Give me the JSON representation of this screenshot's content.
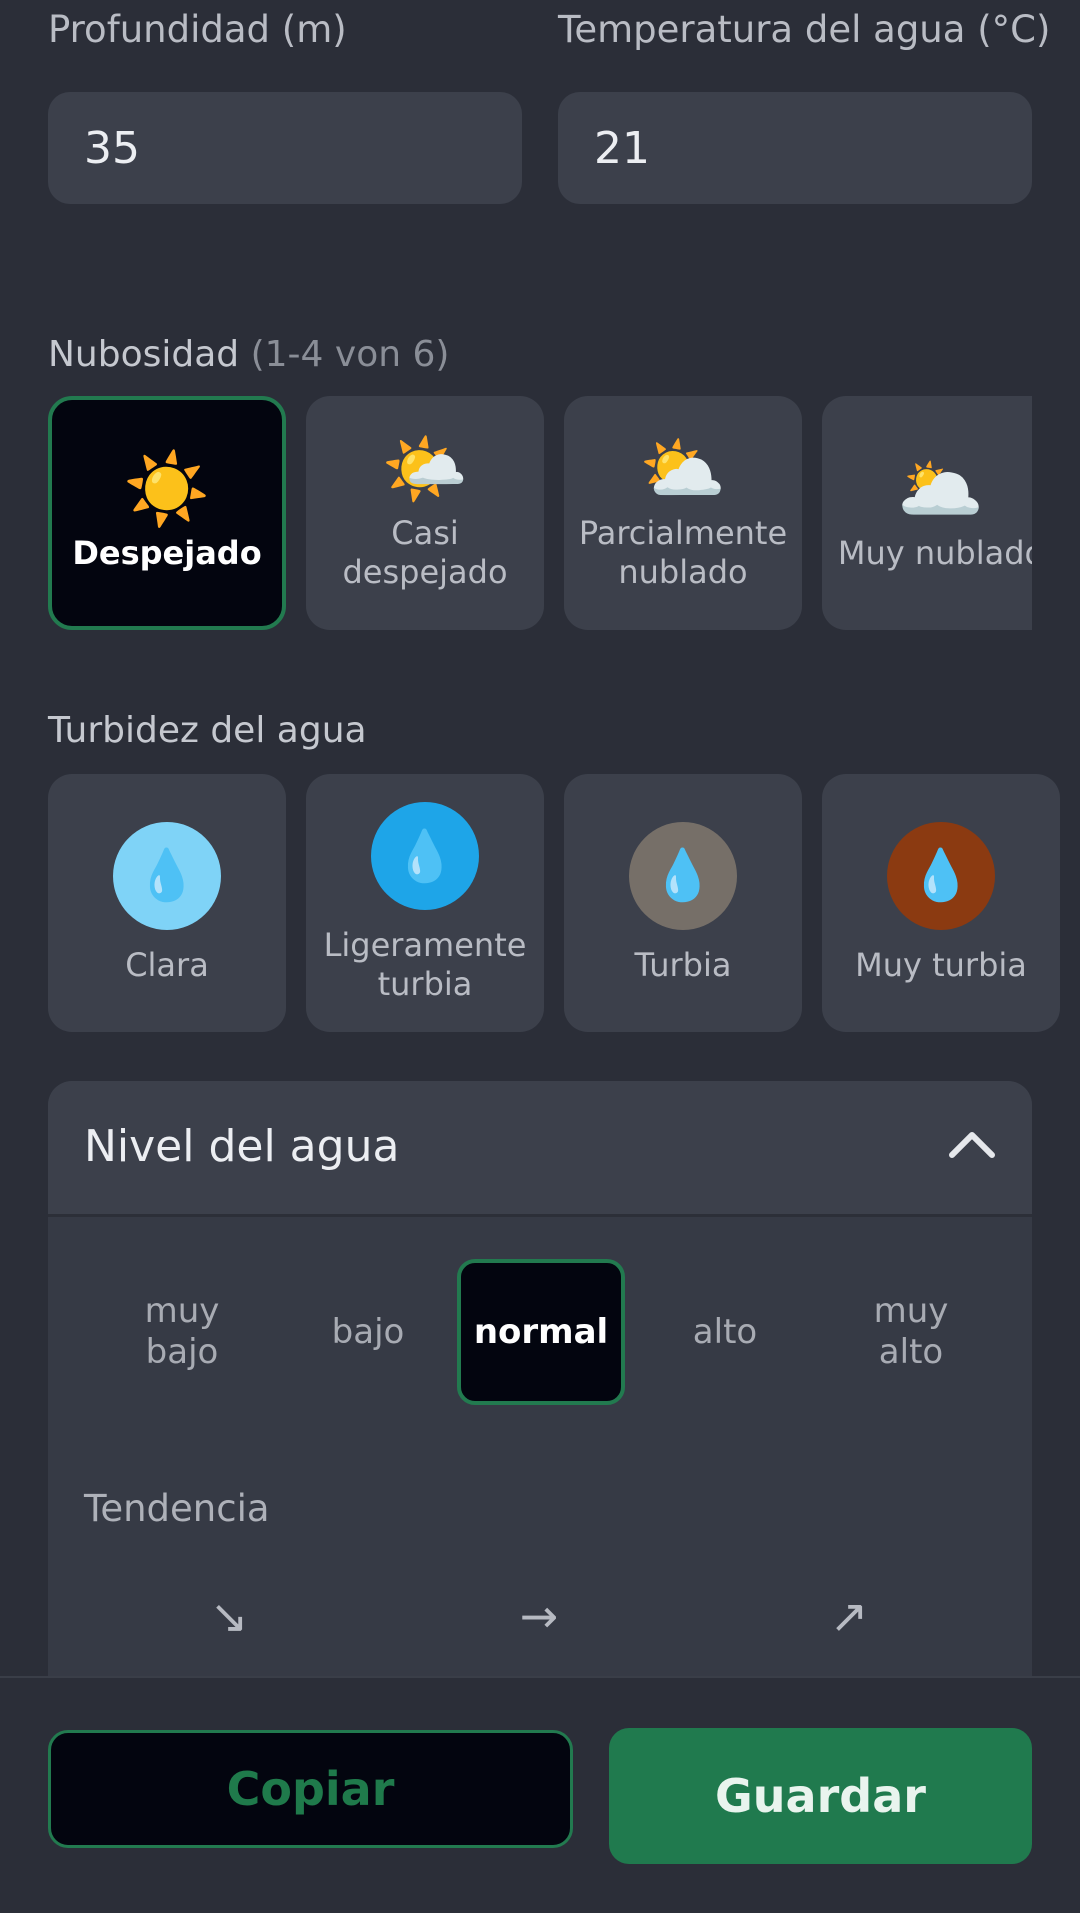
{
  "depth": {
    "label": "Profundidad (m)",
    "value": "35"
  },
  "water_temp": {
    "label": "Temperatura del agua (°C)",
    "value": "21"
  },
  "cloudiness": {
    "title": "Nubosidad",
    "counter": "(1-4 von 6)",
    "options": [
      {
        "icon": "☀️",
        "label": "Despejado"
      },
      {
        "icon": "🌤️",
        "label": "Casi\ndespejado"
      },
      {
        "icon": "⛅",
        "label": "Parcialmente\nnublado"
      },
      {
        "icon": "🌥️",
        "label": "Muy nublado"
      }
    ]
  },
  "turbidity": {
    "title": "Turbidez del agua",
    "options": [
      {
        "icon": "💧",
        "label": "Clara",
        "color": "#7fd3f7"
      },
      {
        "icon": "💧",
        "label": "Ligeramente\nturbia",
        "color": "#1ea5e8"
      },
      {
        "icon": "💧",
        "label": "Turbia",
        "color": "#766f68"
      },
      {
        "icon": "💧",
        "label": "Muy turbia",
        "color": "#8b3a11"
      }
    ]
  },
  "water_level": {
    "title": "Nivel del agua",
    "levels": [
      "muy\nbajo",
      "bajo",
      "normal",
      "alto",
      "muy\nalto"
    ],
    "selected": "normal",
    "trend_title": "Tendencia",
    "trend_arrows": [
      "↘",
      "→",
      "↗"
    ]
  },
  "actions": {
    "copy": "Copiar",
    "save": "Guardar"
  },
  "colors": {
    "accent": "#227a4f",
    "background": "#2b2e38",
    "card": "#3c404b"
  }
}
